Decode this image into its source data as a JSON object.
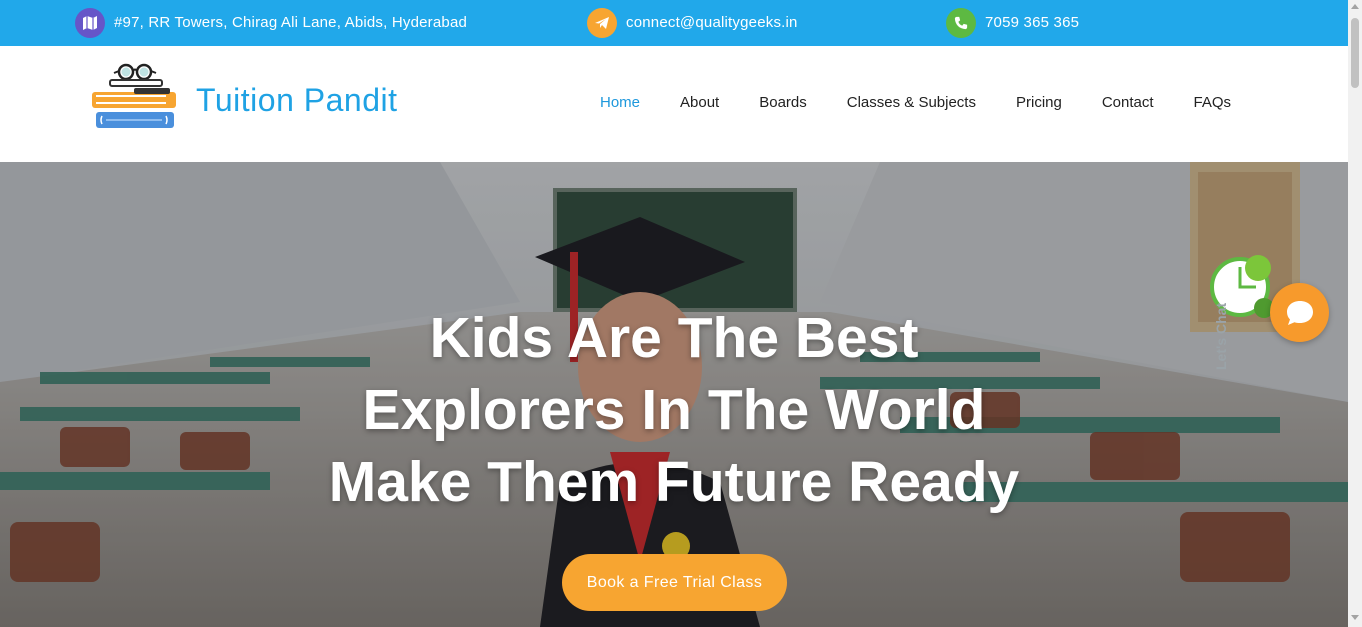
{
  "topbar": {
    "address": {
      "icon": "map-icon",
      "text": "#97, RR Towers, Chirag Ali Lane, Abids, Hyderabad",
      "color": "#6655c8"
    },
    "email": {
      "icon": "telegram-icon",
      "text": "connect@qualitygeeks.in",
      "color": "#f7a531"
    },
    "phone": {
      "icon": "phone-icon",
      "text": "7059 365 365",
      "color": "#5db942"
    }
  },
  "brand": {
    "name": "Tuition Pandit",
    "logo_icon": "books-glasses-logo"
  },
  "nav": {
    "items": [
      {
        "label": "Home",
        "active": true
      },
      {
        "label": "About"
      },
      {
        "label": "Boards"
      },
      {
        "label": "Classes & Subjects"
      },
      {
        "label": "Pricing"
      },
      {
        "label": "Contact"
      },
      {
        "label": "FAQs"
      }
    ]
  },
  "hero": {
    "lines": [
      "Kids Are The Best",
      "Explorers In The World",
      "Make Them Future Ready"
    ],
    "cta_label": "Book a Free Trial Class"
  },
  "chat": {
    "badge_text": "Let's Chat",
    "icon": "chat-bubble-icon"
  },
  "colors": {
    "topbar_bg": "#21a8ea",
    "brand": "#1fa2e4",
    "accent": "#f7a531",
    "nav_active": "#1e98dc"
  }
}
